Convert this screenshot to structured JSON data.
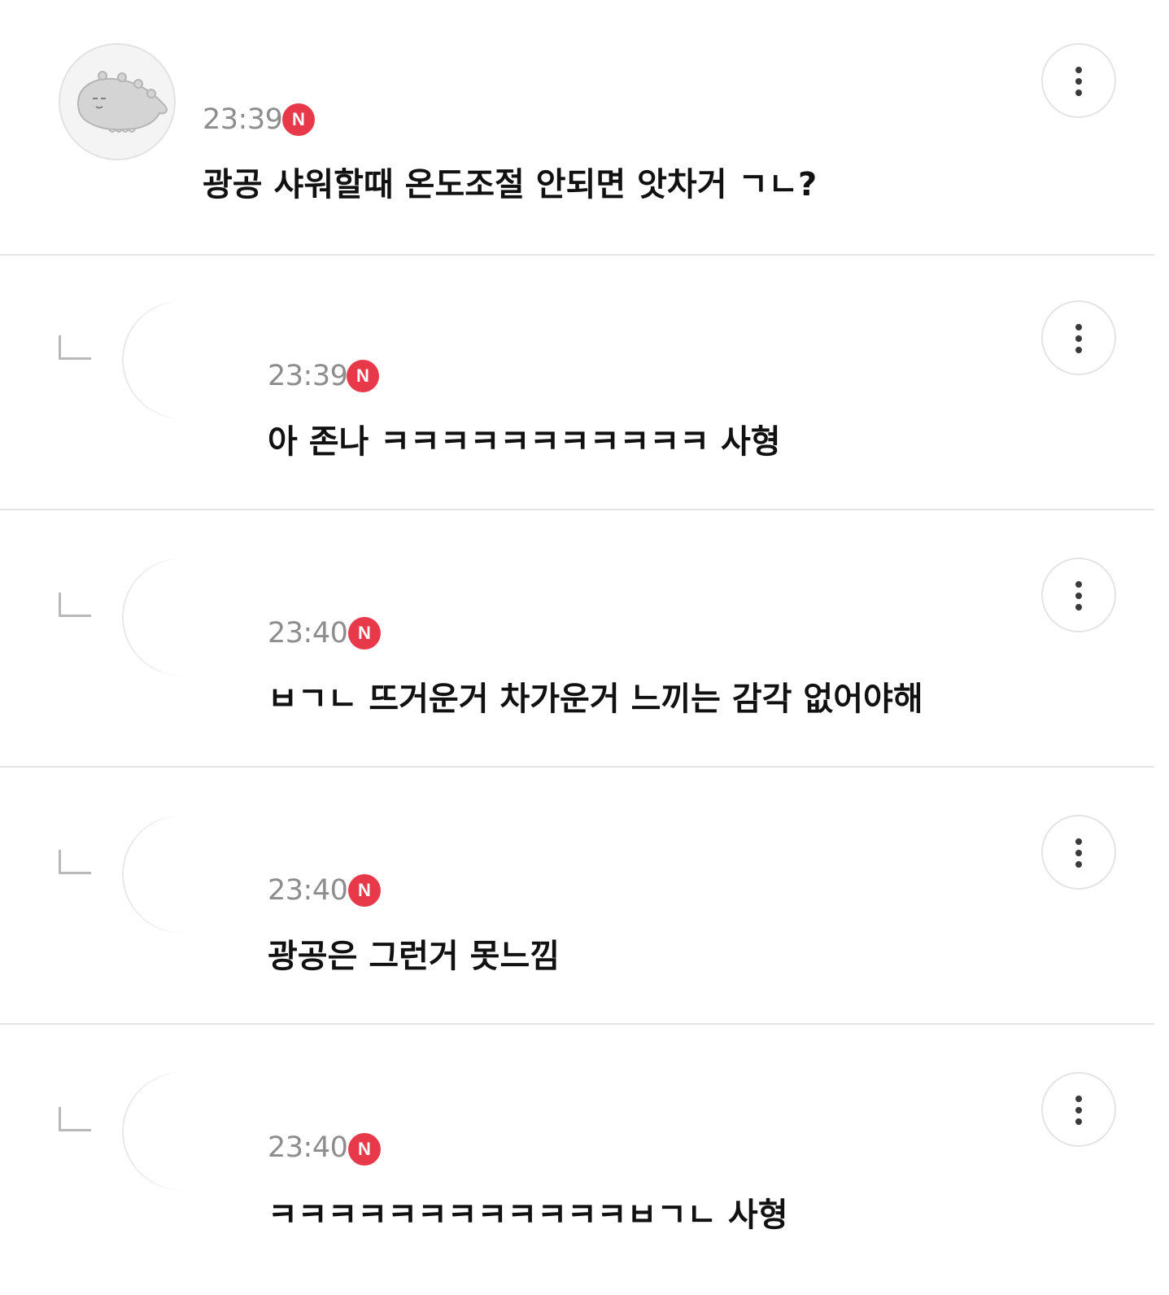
{
  "comments": [
    {
      "nickname": "",
      "time": "23:39",
      "badge": "N",
      "text": "광공 샤워할때 온도조절 안되면 앗차거 ㄱㄴ?"
    },
    {
      "nickname": "",
      "time": "23:39",
      "badge": "N",
      "text": "아 존나 ㅋㅋㅋㅋㅋㅋㅋㅋㅋㅋㅋ 사형"
    },
    {
      "nickname": "",
      "time": "23:40",
      "badge": "N",
      "text": "ㅂㄱㄴ 뜨거운거 차가운거 느끼는 감각 없어야해"
    },
    {
      "nickname": "",
      "time": "23:40",
      "badge": "N",
      "text": "광공은 그런거 못느낌"
    },
    {
      "nickname": "",
      "time": "23:40",
      "badge": "N",
      "text": "ㅋㅋㅋㅋㅋㅋㅋㅋㅋㅋㅋㅋㅂㄱㄴ 사형"
    }
  ],
  "colors": {
    "badge": "#e8394a",
    "time": "#8d8d8d",
    "divider": "#e5e5e5"
  }
}
